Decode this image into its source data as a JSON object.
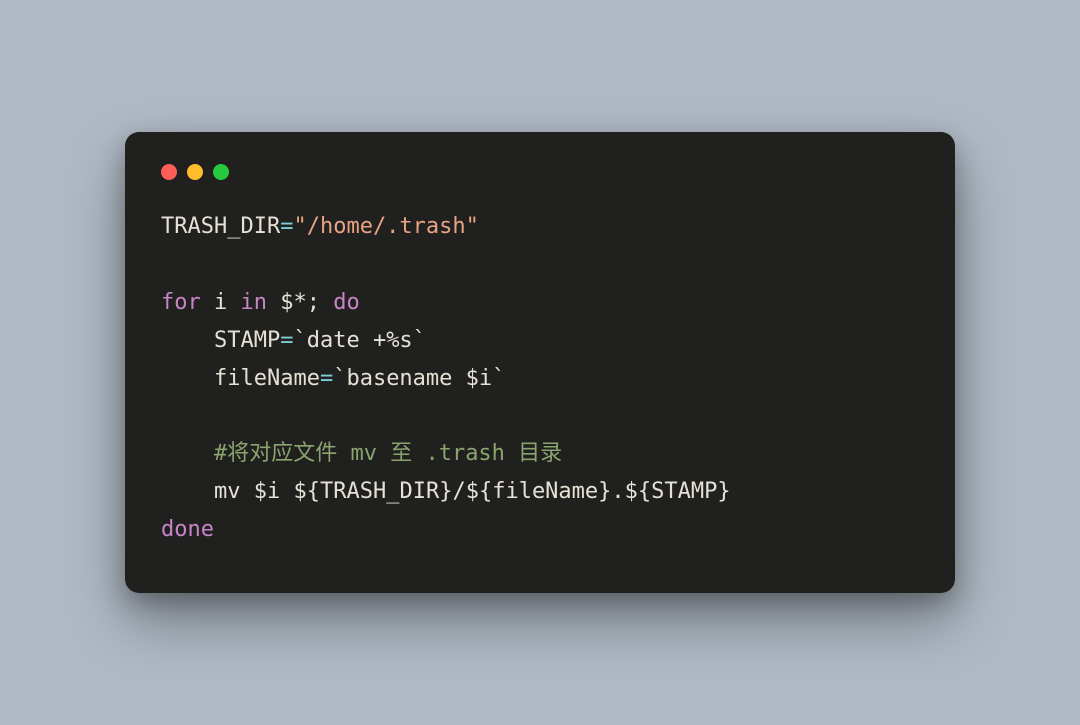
{
  "titlebar": {
    "buttons": [
      "close",
      "minimize",
      "zoom"
    ]
  },
  "code": {
    "line1": {
      "var": "TRASH_DIR",
      "eq": "=",
      "str": "\"/home/.trash\""
    },
    "line3": {
      "for": "for",
      "i": "i",
      "in": "in",
      "args": "$*",
      "semi": ";",
      "do": "do"
    },
    "line4": {
      "indent": "    ",
      "var": "STAMP",
      "eq": "=",
      "bq1": "`",
      "cmd": "date +%s",
      "bq2": "`"
    },
    "line5": {
      "indent": "    ",
      "var": "fileName",
      "eq": "=",
      "bq1": "`",
      "cmd": "basename ",
      "arg": "$i",
      "bq2": "`"
    },
    "line7": {
      "indent": "    ",
      "comment": "#将对应文件 mv 至 .trash 目录"
    },
    "line8": {
      "indent": "    ",
      "cmd": "mv ",
      "arg1": "$i",
      "sp": " ",
      "d1": "${",
      "v1": "TRASH_DIR",
      "d1e": "}",
      "slash": "/",
      "d2": "${",
      "v2": "fileName",
      "d2e": "}",
      "dot": ".",
      "d3": "${",
      "v3": "STAMP",
      "d3e": "}"
    },
    "line9": {
      "done": "done"
    }
  }
}
